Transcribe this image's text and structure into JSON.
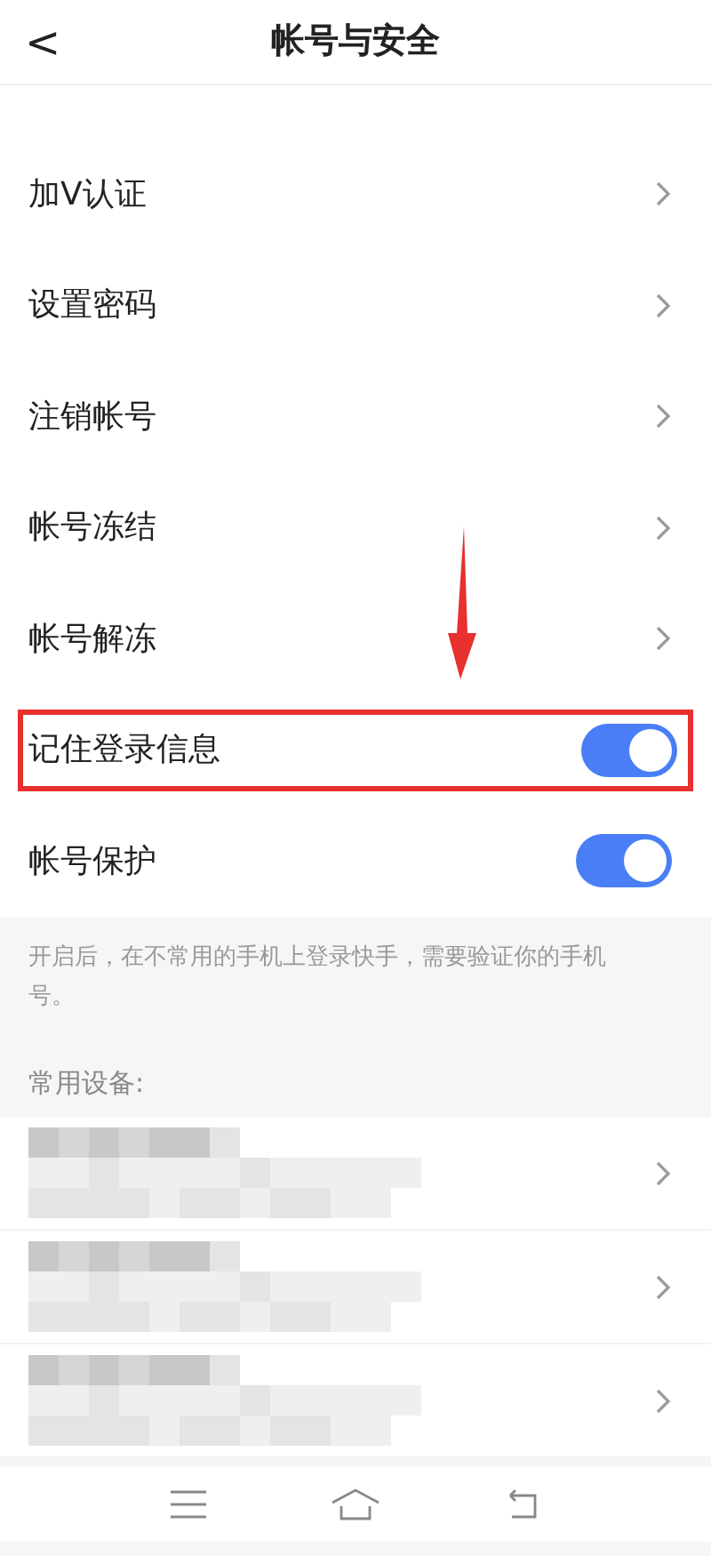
{
  "header": {
    "back": "<",
    "title": "帐号与安全"
  },
  "rows": [
    {
      "kind": "link",
      "label": "加V认证",
      "highlighted": false
    },
    {
      "kind": "link",
      "label": "设置密码",
      "highlighted": false
    },
    {
      "kind": "link",
      "label": "注销帐号",
      "highlighted": false
    },
    {
      "kind": "link",
      "label": "帐号冻结",
      "highlighted": false
    },
    {
      "kind": "link",
      "label": "帐号解冻",
      "highlighted": false
    },
    {
      "kind": "toggle",
      "label": "记住登录信息",
      "on": true,
      "highlighted": true
    },
    {
      "kind": "toggle",
      "label": "帐号保护",
      "on": true,
      "highlighted": false
    }
  ],
  "note": "开启后，在不常用的手机上登录快手，需要验证你的手机号。",
  "devices_title": "常用设备:",
  "devices": [
    {
      "kind": "blurred"
    },
    {
      "kind": "blurred"
    },
    {
      "kind": "blurred"
    }
  ]
}
